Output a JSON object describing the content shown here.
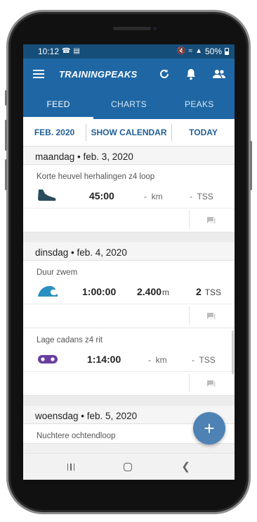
{
  "status": {
    "time": "10:12",
    "battery": "50%"
  },
  "app": {
    "brand": "TRAININGPEAKS"
  },
  "tabs": [
    {
      "label": "FEED",
      "active": true
    },
    {
      "label": "CHARTS",
      "active": false
    },
    {
      "label": "PEAKS",
      "active": false
    }
  ],
  "datebar": {
    "month": "FEB. 2020",
    "calendar": "SHOW CALENDAR",
    "today": "TODAY"
  },
  "days": [
    {
      "date": "maandag • feb. 3, 2020",
      "workouts": [
        {
          "title": "Korte heuvel herhalingen z4 loop",
          "sport_icon": "run-shoe-icon",
          "duration": "45:00",
          "distance": "-",
          "distance_unit": "km",
          "tss": "-",
          "tss_unit": "TSS"
        }
      ]
    },
    {
      "date": "dinsdag • feb. 4, 2020",
      "workouts": [
        {
          "title": "Duur zwem",
          "sport_icon": "swim-wave-icon",
          "duration": "1:00:00",
          "distance": "2.400",
          "distance_unit": "m",
          "tss": "2",
          "tss_unit": "TSS"
        },
        {
          "title": "Lage cadans z4 rit",
          "sport_icon": "bike-chain-icon",
          "duration": "1:14:00",
          "distance": "-",
          "distance_unit": "km",
          "tss": "-",
          "tss_unit": "TSS"
        }
      ]
    },
    {
      "date": "woensdag • feb. 5, 2020",
      "workouts": [
        {
          "title": "Nuchtere ochtendloop"
        }
      ]
    }
  ],
  "fab": {
    "label": "+"
  },
  "colors": {
    "appbar": "#1f67a4",
    "statusbar": "#164e7a",
    "run": "#2a4d5e",
    "swim": "#2a8fc1",
    "bike": "#6a3fa0",
    "fab": "#4e82b4"
  }
}
